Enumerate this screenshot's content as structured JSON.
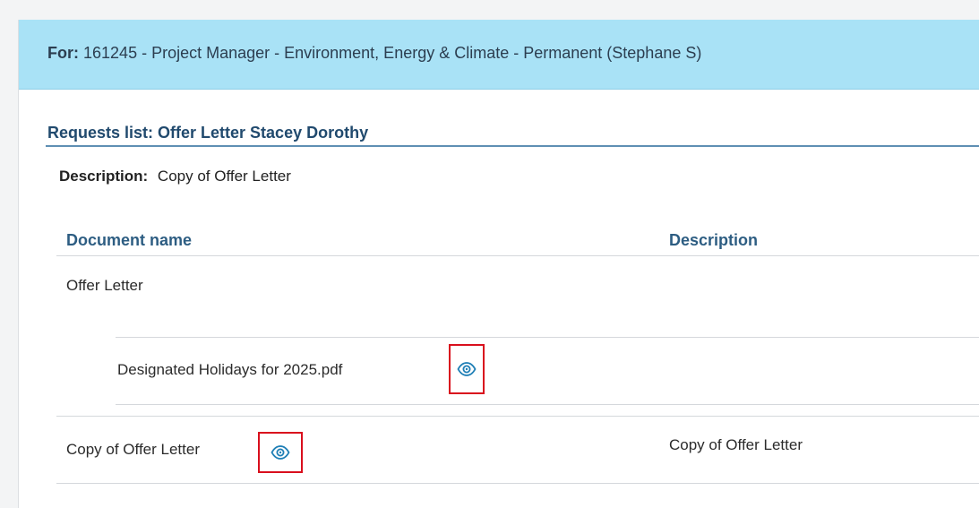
{
  "header": {
    "for_label": "For:",
    "for_value": "161245 - Project Manager - Environment, Energy & Climate - Permanent (Stephane S)"
  },
  "request": {
    "title": "Requests list: Offer Letter Stacey Dorothy",
    "description_label": "Description:",
    "description_value": "Copy of Offer Letter"
  },
  "table": {
    "columns": [
      "Document name",
      "Description"
    ],
    "rows": [
      {
        "name": "Offer Letter",
        "description": "",
        "attachments": [
          {
            "file": "Designated Holidays for 2025.pdf",
            "icon": "eye-icon"
          }
        ]
      },
      {
        "name": "Copy of Offer Letter",
        "description": "Copy of Offer Letter",
        "icon": "eye-icon"
      }
    ]
  },
  "colors": {
    "header_bg": "#a9e2f6",
    "title_color": "#214a6e",
    "icon_color": "#1f7fb6",
    "highlight": "#d90f1d"
  }
}
